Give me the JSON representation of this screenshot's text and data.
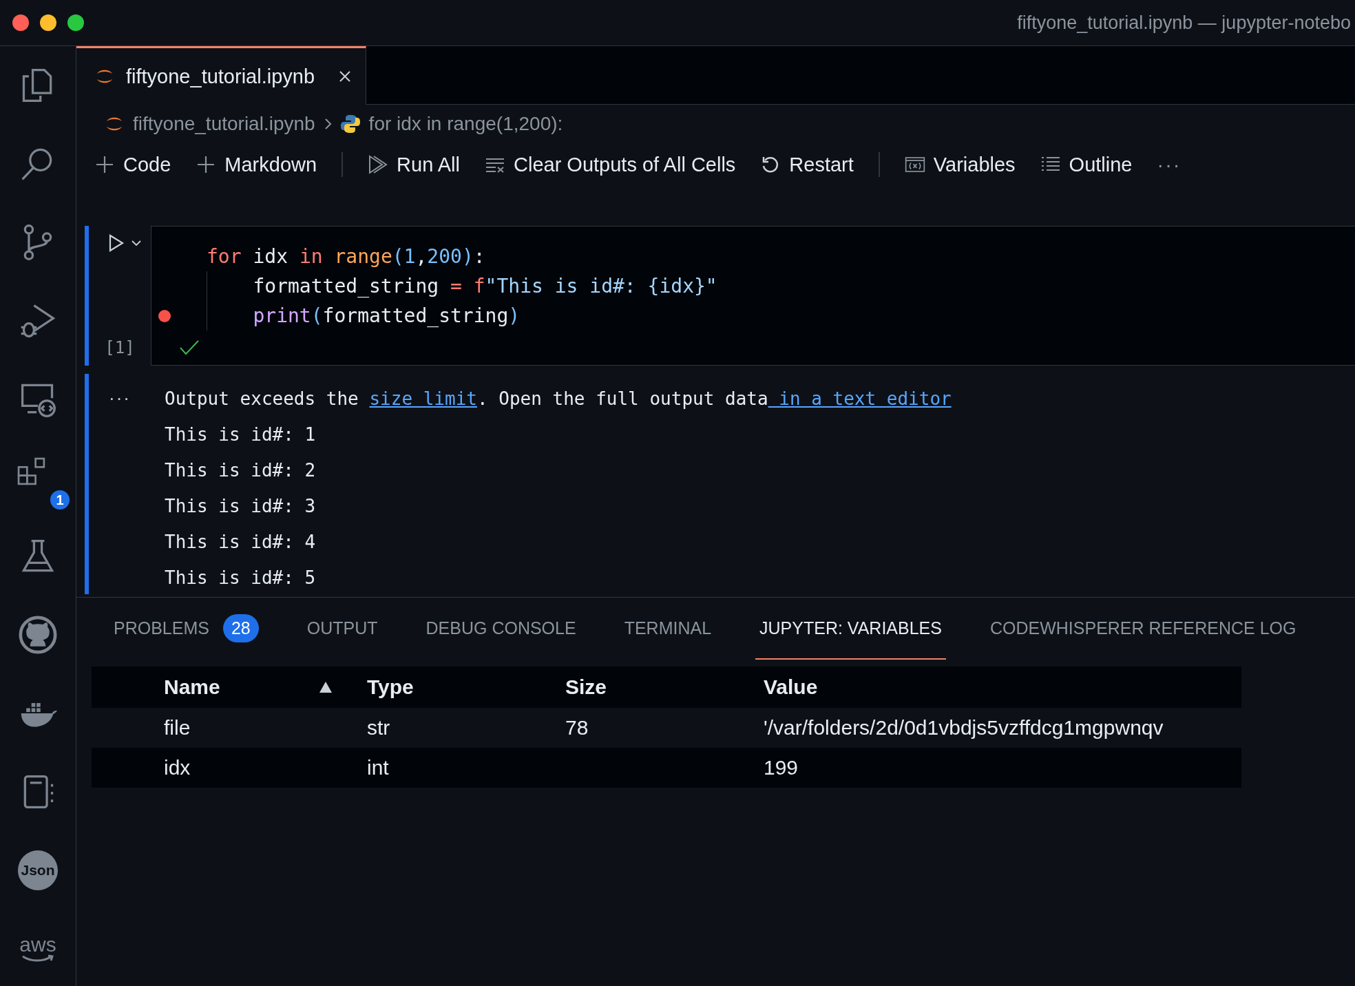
{
  "window": {
    "title": "fiftyone_tutorial.ipynb — jupypter-notebo"
  },
  "activity_bar": [
    {
      "kind": "files"
    },
    {
      "kind": "search"
    },
    {
      "kind": "source-control"
    },
    {
      "kind": "run-debug"
    },
    {
      "kind": "remote"
    },
    {
      "kind": "extensions",
      "badge": "1"
    },
    {
      "kind": "testing"
    },
    {
      "kind": "github"
    },
    {
      "kind": "docker"
    },
    {
      "kind": "notebook"
    },
    {
      "kind": "json",
      "label": "Json"
    },
    {
      "kind": "aws",
      "label": "aws"
    }
  ],
  "editor_tabs": [
    {
      "label": "fiftyone_tutorial.ipynb",
      "selected": true
    }
  ],
  "breadcrumb": [
    {
      "kind": "notebook",
      "label": "fiftyone_tutorial.ipynb"
    },
    {
      "kind": "python",
      "label": "for idx in range(1,200):"
    }
  ],
  "toolbar": [
    {
      "kind": "add",
      "label": "Code"
    },
    {
      "kind": "add",
      "label": "Markdown"
    },
    {
      "kind": "separator"
    },
    {
      "kind": "run-all",
      "label": "Run All"
    },
    {
      "kind": "clear",
      "label": "Clear Outputs of All Cells"
    },
    {
      "kind": "restart",
      "label": "Restart"
    },
    {
      "kind": "separator"
    },
    {
      "kind": "variables",
      "label": "Variables"
    },
    {
      "kind": "outline",
      "label": "Outline"
    },
    {
      "kind": "more",
      "label": "···"
    }
  ],
  "cell": {
    "execution_count": "[1]",
    "success": true,
    "lines": [
      {
        "breakpoint": false,
        "indented": false,
        "tokens": [
          {
            "text": "for",
            "kind": "keyword"
          },
          {
            "text": " idx ",
            "kind": "plain"
          },
          {
            "text": "in",
            "kind": "keyword"
          },
          {
            "text": " range",
            "kind": "function"
          },
          {
            "text": "(",
            "kind": "paren"
          },
          {
            "text": "1",
            "kind": "number"
          },
          {
            "text": ",",
            "kind": "plain"
          },
          {
            "text": "200",
            "kind": "number"
          },
          {
            "text": ")",
            "kind": "paren"
          },
          {
            "text": ":",
            "kind": "plain"
          }
        ]
      },
      {
        "breakpoint": false,
        "indented": true,
        "tokens": [
          {
            "text": "formatted_string ",
            "kind": "plain"
          },
          {
            "text": "=",
            "kind": "keyword"
          },
          {
            "text": " f",
            "kind": "keyword"
          },
          {
            "text": "\"This is id#: {idx}\"",
            "kind": "string"
          }
        ]
      },
      {
        "breakpoint": true,
        "indented": true,
        "tokens": [
          {
            "text": "print",
            "kind": "builtin"
          },
          {
            "text": "(",
            "kind": "paren"
          },
          {
            "text": "formatted_string",
            "kind": "plain"
          },
          {
            "text": ")",
            "kind": "paren"
          }
        ]
      }
    ],
    "output": {
      "more": "···",
      "message": [
        {
          "text": "Output exceeds the ",
          "link": false
        },
        {
          "text": "size limit",
          "link": true
        },
        {
          "text": ". Open the full output data",
          "link": false
        },
        {
          "text": " in a text editor",
          "link": true
        }
      ],
      "lines": [
        "This is id#: 1",
        "This is id#: 2",
        "This is id#: 3",
        "This is id#: 4",
        "This is id#: 5"
      ]
    }
  },
  "panel": {
    "tabs": [
      {
        "label": "PROBLEMS",
        "badge": "28",
        "selected": false
      },
      {
        "label": "OUTPUT",
        "selected": false
      },
      {
        "label": "DEBUG CONSOLE",
        "selected": false
      },
      {
        "label": "TERMINAL",
        "selected": false
      },
      {
        "label": "JUPYTER: VARIABLES",
        "selected": true
      },
      {
        "label": "CODEWHISPERER REFERENCE LOG",
        "selected": false
      }
    ],
    "table": {
      "columns": [
        {
          "label": "Name",
          "sorted": true
        },
        {
          "label": "Type",
          "sorted": false
        },
        {
          "label": "Size",
          "sorted": false
        },
        {
          "label": "Value",
          "sorted": false
        }
      ],
      "rows": [
        {
          "name": "file",
          "type": "str",
          "size": "78",
          "value": "'/var/folders/2d/0d1vbdjs5vzffdcg1mgpwnqv"
        },
        {
          "name": "idx",
          "type": "int",
          "value": "199"
        }
      ]
    }
  }
}
